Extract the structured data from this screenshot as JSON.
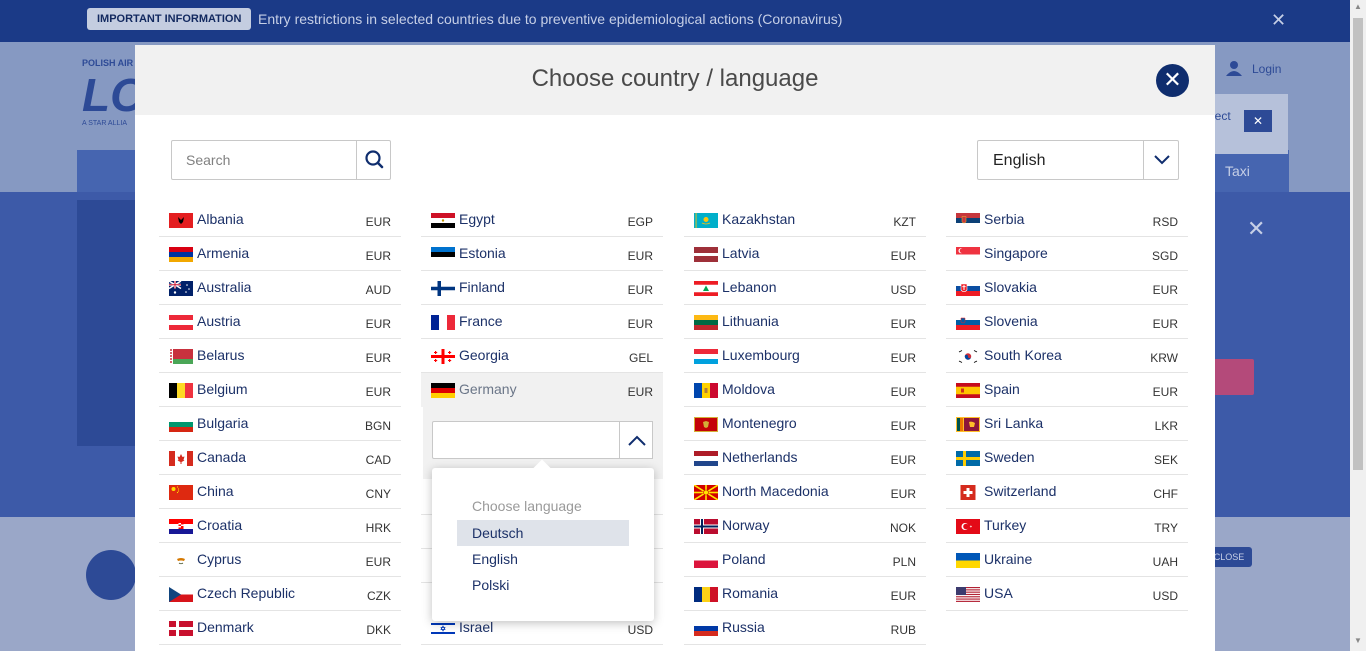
{
  "banner": {
    "badge": "IMPORTANT INFORMATION",
    "message": "Entry restrictions in selected countries due to preventive epidemiological actions (Coronavirus)"
  },
  "background": {
    "login": "Login",
    "taxi": "Taxi",
    "close_label": "CLOSE",
    "logo_top": "POLISH AIR",
    "logo_big": "LO",
    "logo_bottom": "A STAR ALLIA",
    "select_peek": "lect"
  },
  "modal": {
    "title": "Choose country / language",
    "search_placeholder": "Search",
    "language_value": "English"
  },
  "countries": {
    "col1": [
      {
        "name": "Albania",
        "currency": "EUR",
        "flag": "albania"
      },
      {
        "name": "Armenia",
        "currency": "EUR",
        "flag": "armenia"
      },
      {
        "name": "Australia",
        "currency": "AUD",
        "flag": "australia"
      },
      {
        "name": "Austria",
        "currency": "EUR",
        "flag": "austria"
      },
      {
        "name": "Belarus",
        "currency": "EUR",
        "flag": "belarus"
      },
      {
        "name": "Belgium",
        "currency": "EUR",
        "flag": "belgium"
      },
      {
        "name": "Bulgaria",
        "currency": "BGN",
        "flag": "bulgaria"
      },
      {
        "name": "Canada",
        "currency": "CAD",
        "flag": "canada"
      },
      {
        "name": "China",
        "currency": "CNY",
        "flag": "china"
      },
      {
        "name": "Croatia",
        "currency": "HRK",
        "flag": "croatia"
      },
      {
        "name": "Cyprus",
        "currency": "EUR",
        "flag": "cyprus"
      },
      {
        "name": "Czech Republic",
        "currency": "CZK",
        "flag": "czech"
      },
      {
        "name": "Denmark",
        "currency": "DKK",
        "flag": "denmark"
      }
    ],
    "col2": [
      {
        "name": "Egypt",
        "currency": "EGP",
        "flag": "egypt"
      },
      {
        "name": "Estonia",
        "currency": "EUR",
        "flag": "estonia"
      },
      {
        "name": "Finland",
        "currency": "EUR",
        "flag": "finland"
      },
      {
        "name": "France",
        "currency": "EUR",
        "flag": "france"
      },
      {
        "name": "Georgia",
        "currency": "GEL",
        "flag": "georgia"
      },
      {
        "name": "Germany",
        "currency": "EUR",
        "flag": "germany",
        "active": true
      }
    ],
    "col2_tail": {
      "name": "Israel",
      "currency": "USD",
      "flag": "israel"
    },
    "col3": [
      {
        "name": "Kazakhstan",
        "currency": "KZT",
        "flag": "kazakhstan"
      },
      {
        "name": "Latvia",
        "currency": "EUR",
        "flag": "latvia"
      },
      {
        "name": "Lebanon",
        "currency": "USD",
        "flag": "lebanon"
      },
      {
        "name": "Lithuania",
        "currency": "EUR",
        "flag": "lithuania"
      },
      {
        "name": "Luxembourg",
        "currency": "EUR",
        "flag": "luxembourg"
      },
      {
        "name": "Moldova",
        "currency": "EUR",
        "flag": "moldova"
      },
      {
        "name": "Montenegro",
        "currency": "EUR",
        "flag": "montenegro"
      },
      {
        "name": "Netherlands",
        "currency": "EUR",
        "flag": "netherlands"
      },
      {
        "name": "North Macedonia",
        "currency": "EUR",
        "flag": "macedonia"
      },
      {
        "name": "Norway",
        "currency": "NOK",
        "flag": "norway"
      },
      {
        "name": "Poland",
        "currency": "PLN",
        "flag": "poland"
      },
      {
        "name": "Romania",
        "currency": "EUR",
        "flag": "romania"
      },
      {
        "name": "Russia",
        "currency": "RUB",
        "flag": "russia"
      }
    ],
    "col4": [
      {
        "name": "Serbia",
        "currency": "RSD",
        "flag": "serbia"
      },
      {
        "name": "Singapore",
        "currency": "SGD",
        "flag": "singapore"
      },
      {
        "name": "Slovakia",
        "currency": "EUR",
        "flag": "slovakia"
      },
      {
        "name": "Slovenia",
        "currency": "EUR",
        "flag": "slovenia"
      },
      {
        "name": "South Korea",
        "currency": "KRW",
        "flag": "south-korea"
      },
      {
        "name": "Spain",
        "currency": "EUR",
        "flag": "spain"
      },
      {
        "name": "Sri Lanka",
        "currency": "LKR",
        "flag": "sri-lanka"
      },
      {
        "name": "Sweden",
        "currency": "SEK",
        "flag": "sweden"
      },
      {
        "name": "Switzerland",
        "currency": "CHF",
        "flag": "switzerland"
      },
      {
        "name": "Turkey",
        "currency": "TRY",
        "flag": "turkey"
      },
      {
        "name": "Ukraine",
        "currency": "UAH",
        "flag": "ukraine"
      },
      {
        "name": "USA",
        "currency": "USD",
        "flag": "usa"
      }
    ]
  },
  "language_popup": {
    "title": "Choose language",
    "options": [
      {
        "label": "Deutsch",
        "selected": true
      },
      {
        "label": "English",
        "selected": false
      },
      {
        "label": "Polski",
        "selected": false
      }
    ]
  }
}
